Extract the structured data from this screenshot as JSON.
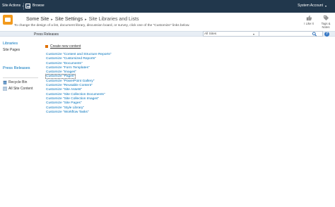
{
  "topbar": {
    "site_actions": "Site Actions",
    "browse": "Browse",
    "user": "System Account"
  },
  "breadcrumb": {
    "site": "Some Site",
    "settings": "Site Settings",
    "current": "Site Libraries and Lists",
    "separator": "▸"
  },
  "description": "To change the design of a list, document library, discussion board, or survey, click one of the \"Customize\" links below.",
  "actions": {
    "like": "I Like It",
    "tags_line1": "Tags &",
    "tags_line2": "Notes"
  },
  "topnav": {
    "item": "Press Releases"
  },
  "search": {
    "scope": "All Sites"
  },
  "help": "?",
  "left_nav": {
    "libraries_heading": "Libraries",
    "site_pages": "Site Pages",
    "press_releases_heading": "Press Releases",
    "recycle_bin": "Recycle Bin",
    "all_site_content": "All Site Content"
  },
  "content": {
    "create_new": "Create new content",
    "libraries": [
      "Customize \"Content and Structure Reports\"",
      "Customize \"Customized Reports\"",
      "Customize \"Documents\"",
      "Customize \"Form Templates\"",
      "Customize \"Images\"",
      "Customize \"Pages\"",
      "Customize \"PowerPoint Gallery\"",
      "Customize \"Reusable Content\"",
      "Customize \"Site Assets\"",
      "Customize \"Site Collection Documents\"",
      "Customize \"Site Collection Images\"",
      "Customize \"Site Pages\"",
      "Customize \"Style Library\"",
      "Customize \"Workflow Tasks\""
    ],
    "selected_index": 5
  },
  "icons": {
    "site_actions_dropdown": "chevron-down-icon",
    "navigate_up": "navigate-up-icon",
    "site_logo": "site-logo-icon",
    "like": "thumbs-up-icon",
    "tags": "tag-icon",
    "search": "search-icon",
    "help": "help-icon",
    "recycle_bin": "recycle-bin-icon",
    "all_site_content": "site-content-icon",
    "create": "bullet-icon"
  },
  "colors": {
    "topbar": "#21374c",
    "link": "#0072bc",
    "topnav": "#e8eef5",
    "site_icon": "#f29a1d"
  }
}
